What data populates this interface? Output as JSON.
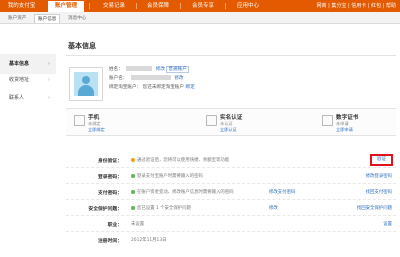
{
  "topnav": {
    "tabs": [
      {
        "label": "我的支付宝"
      },
      {
        "label": "账户管理"
      },
      {
        "label": "交易记录"
      },
      {
        "label": "会员保障"
      },
      {
        "label": "会员专享"
      },
      {
        "label": "应用中心"
      }
    ],
    "right_links": "网商 | 集分宝 | 信用卡 | 红包 | 帮助"
  },
  "subnav": {
    "tabs": [
      {
        "label": "账户资产"
      },
      {
        "label": "账户信息"
      },
      {
        "label": "消息中心"
      }
    ]
  },
  "sidebar": {
    "items": [
      {
        "label": "基本信息"
      },
      {
        "label": "收货地址"
      },
      {
        "label": "联系人"
      }
    ]
  },
  "main": {
    "title": "基本信息",
    "profile": {
      "name_label": "姓名：",
      "name_link": "修改",
      "name_badge": "普通账户",
      "account_label": "账户名：",
      "account_link": "修改",
      "bind_label": "绑定淘宝账户：",
      "bind_text": "您还未绑定淘宝账户",
      "bind_link": "绑定"
    },
    "cards": [
      {
        "title": "手机",
        "status": "未绑定",
        "link": "立即绑定"
      },
      {
        "title": "实名认证",
        "status": "未认证",
        "link": "立即认证"
      },
      {
        "title": "数字证书",
        "status": "未申请",
        "link": "立即申请"
      }
    ],
    "security": [
      {
        "label": "身份验证：",
        "desc": "通过验证后，您将可以使用快捷、余额宝等功能",
        "action": "验证"
      },
      {
        "label": "登录密码：",
        "desc": "登录支付宝账户时需要输入的密码",
        "action": "修改登录密码"
      },
      {
        "label": "支付密码：",
        "desc": "在账户资金变动、修改账户信息时需要输入的密码",
        "mid": "修改支付密码",
        "action": "找回支付密码"
      },
      {
        "label": "安全保护问题：",
        "desc": "您已设置 1 个安全保护问题",
        "mid": "修改",
        "action": "找回安全保护问题"
      },
      {
        "label": "职业：",
        "desc": "未设置",
        "action": "设置"
      },
      {
        "label": "注册时间：",
        "desc": "2012年11月13日",
        "action": ""
      }
    ]
  }
}
